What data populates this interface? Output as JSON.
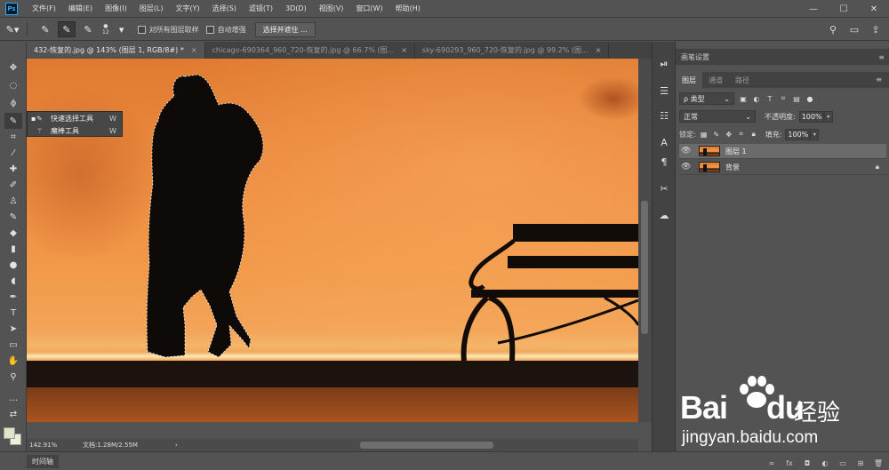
{
  "app": {
    "logo": "Ps"
  },
  "menu": [
    "文件(F)",
    "编辑(E)",
    "图像(I)",
    "图层(L)",
    "文字(Y)",
    "选择(S)",
    "滤镜(T)",
    "3D(D)",
    "视图(V)",
    "窗口(W)",
    "帮助(H)"
  ],
  "window_controls": {
    "minimize": "—",
    "maximize": "☐",
    "close": "✕"
  },
  "options": {
    "brush_size": "12",
    "sample_all_layers": "对所有图层取样",
    "auto_enhance": "自动增强",
    "select_and_mask": "选择并遮住 ..."
  },
  "tabs": [
    {
      "label": "432-恢复的.jpg @ 143% (图层 1, RGB/8#) *",
      "close": "×"
    },
    {
      "label": "chicago-690364_960_720-恢复的.jpg @ 66.7% (图...",
      "close": "×"
    },
    {
      "label": "sky-690293_960_720-恢复的.jpg @ 99.2% (图...",
      "close": "×"
    }
  ],
  "flyout": [
    {
      "bullet": "▪",
      "label": "快速选择工具",
      "key": "W"
    },
    {
      "bullet": "",
      "label": "魔棒工具",
      "key": "W"
    }
  ],
  "status": {
    "zoom": "142.91%",
    "doc": "文档:1.28M/2.55M",
    "arrow": "›"
  },
  "timeline": {
    "label": "时间轴"
  },
  "panels": {
    "brush_settings": "画笔设置",
    "layers_tabs": [
      "图层",
      "通道",
      "路径"
    ],
    "menu_glyph": "≡",
    "filter_kind": "ρ 类型",
    "blend_mode": "正常",
    "opacity_label": "不透明度:",
    "opacity_value": "100%",
    "lock_label": "锁定:",
    "fill_label": "填充:",
    "fill_value": "100%",
    "layers": [
      {
        "name": "图层 1",
        "selected": true,
        "locked": false
      },
      {
        "name": "背景",
        "selected": false,
        "locked": true
      }
    ]
  },
  "watermark": {
    "brand_a": "Bai",
    "brand_b": "du",
    "cn": "经验",
    "url": "jingyan.baidu.com"
  }
}
